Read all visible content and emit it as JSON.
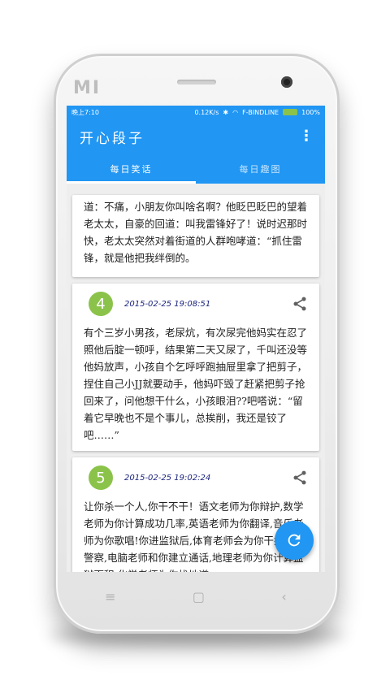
{
  "device": {
    "brand_logo": "MI"
  },
  "status_bar": {
    "time": "晚上7:10",
    "speed": "0.12K/s",
    "carrier": "F-BINDLINE",
    "battery": "100%"
  },
  "app": {
    "title": "开心段子",
    "menu_icon": "more-vert-icon"
  },
  "tabs": [
    {
      "label": "每日笑话",
      "active": true
    },
    {
      "label": "每日趣图",
      "active": false
    }
  ],
  "cards": [
    {
      "text": "道：不痛，小朋友你叫啥名啊？他眨巴眨巴的望着老太太，自豪的回道：叫我雷锋好了！说时迟那时快，老太太突然对着街道的人群咆哮道：“抓住雷锋，就是他把我绊倒的。"
    },
    {
      "number": "4",
      "date": "2015-02-25 19:08:51",
      "text": "有个三岁小男孩，老尿炕，有次尿完他妈实在忍了照他后腚一顿呼，结果第二天又尿了，千叫还没等他妈放声，小孩自个乞呼呼跑抽屉里拿了把剪子，捏住自己小JJ就要动手，他妈吓毁了赶紧把剪子抢回来了，问他想干什么，小孩眼泪??吧嗒说：“留着它早晚也不是个事儿，总挨削，我还是铰了吧……”"
    },
    {
      "number": "5",
      "date": "2015-02-25 19:02:24",
      "text": "让你杀一个人,你干不干！语文老师为你辩护,数学老师为你计算成功几率,英语老师为你翻译,音乐老师为你歌唱!你进监狱后,体育老师会为你干掉门口警察,电脑老师和你建立通话,地理老师为你计算监狱面积,化学老师为你找地道..."
    }
  ],
  "fab": {
    "icon": "refresh-icon"
  },
  "nav": {
    "menu_icon": "menu-icon",
    "home_icon": "home-icon",
    "back_icon": "back-icon"
  },
  "colors": {
    "primary": "#2196f3",
    "badge": "#8bc34a",
    "date": "#1a237e"
  }
}
